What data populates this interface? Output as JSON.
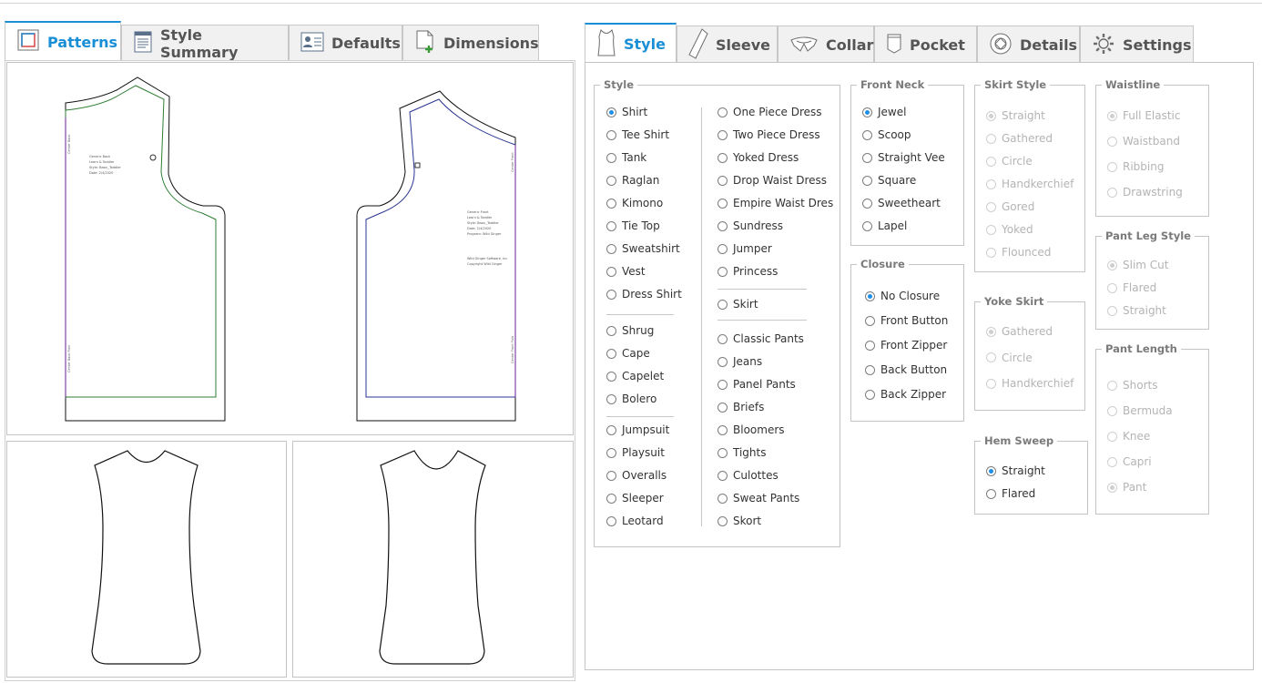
{
  "left_tabs": [
    {
      "label": "Patterns",
      "icon": "patterns-icon",
      "active": true
    },
    {
      "label": "Style Summary",
      "icon": "style-summary-icon",
      "active": false
    },
    {
      "label": "Defaults",
      "icon": "defaults-icon",
      "active": false
    },
    {
      "label": "Dimensions",
      "icon": "dimensions-icon",
      "active": false
    }
  ],
  "right_tabs": [
    {
      "label": "Style",
      "icon": "tank-top-icon",
      "active": true
    },
    {
      "label": "Sleeve",
      "icon": "sleeve-icon",
      "active": false
    },
    {
      "label": "Collar",
      "icon": "collar-icon",
      "active": false
    },
    {
      "label": "Pocket",
      "icon": "pocket-icon",
      "active": false
    },
    {
      "label": "Details",
      "icon": "details-icon",
      "active": false
    },
    {
      "label": "Settings",
      "icon": "gear-icon",
      "active": false
    }
  ],
  "pattern_back": {
    "lines": [
      "Generic Back",
      "Learn & Toddler",
      "Style: Basic_Toddler",
      "Date: 2/4/2020"
    ],
    "side_labels": [
      "Center Back",
      "Center Back Fold"
    ]
  },
  "pattern_front": {
    "lines": [
      "Generic Front",
      "Learn & Toddler",
      "Style: Basic_Toddler",
      "Date: 2/4/2020",
      "Program: Wild Ginger"
    ],
    "copyright": [
      "Wild Ginger Software, Inc",
      "Copyright Wild Ginger"
    ],
    "side_labels": [
      "Center Front",
      "Center Front Fold"
    ]
  },
  "groups": {
    "style": {
      "title": "Style",
      "col1a": [
        "Shirt",
        "Tee Shirt",
        "Tank",
        "Raglan",
        "Kimono",
        "Tie Top",
        "Sweatshirt",
        "Vest",
        "Dress Shirt"
      ],
      "col1b": [
        "Shrug",
        "Cape",
        "Capelet",
        "Bolero"
      ],
      "col1c": [
        "Jumpsuit",
        "Playsuit",
        "Overalls",
        "Sleeper",
        "Leotard"
      ],
      "col2a": [
        "One Piece Dress",
        "Two Piece Dress",
        "Yoked Dress",
        "Drop Waist Dress",
        "Empire Waist Dres",
        "Sundress",
        "Jumper",
        "Princess"
      ],
      "col2b": [
        "Skirt"
      ],
      "col2c": [
        "Classic Pants",
        "Jeans",
        "Panel Pants",
        "Briefs",
        "Bloomers",
        "Tights",
        "Culottes",
        "Sweat Pants",
        "Skort"
      ],
      "selected": "Shirt"
    },
    "front_neck": {
      "title": "Front Neck",
      "options": [
        "Jewel",
        "Scoop",
        "Straight Vee",
        "Square",
        "Sweetheart",
        "Lapel"
      ],
      "selected": "Jewel"
    },
    "closure": {
      "title": "Closure",
      "options": [
        "No Closure",
        "Front Button",
        "Front Zipper",
        "Back Button",
        "Back Zipper"
      ],
      "selected": "No Closure"
    },
    "skirt_style": {
      "title": "Skirt Style",
      "options": [
        "Straight",
        "Gathered",
        "Circle",
        "Handkerchief",
        "Gored",
        "Yoked",
        "Flounced"
      ],
      "selected": "Straight"
    },
    "yoke_skirt": {
      "title": "Yoke Skirt",
      "options": [
        "Gathered",
        "Circle",
        "Handkerchief"
      ],
      "selected": "Gathered"
    },
    "hem_sweep": {
      "title": "Hem Sweep",
      "options": [
        "Straight",
        "Flared"
      ],
      "selected": "Straight"
    },
    "waistline": {
      "title": "Waistline",
      "options": [
        "Full Elastic",
        "Waistband",
        "Ribbing",
        "Drawstring"
      ],
      "selected": "Full Elastic"
    },
    "pant_leg_style": {
      "title": "Pant Leg Style",
      "options": [
        "Slim Cut",
        "Flared",
        "Straight"
      ],
      "selected": "Slim Cut"
    },
    "pant_length": {
      "title": "Pant Length",
      "options": [
        "Shorts",
        "Bermuda",
        "Knee",
        "Capri",
        "Pant"
      ],
      "selected": "Pant"
    }
  },
  "colors": {
    "accent": "#1a8fd6",
    "radio_selected": "#1e8ee6",
    "disabled_text": "#b4b4b4",
    "back_seam": "#2e7d32",
    "front_seam": "#283593"
  }
}
